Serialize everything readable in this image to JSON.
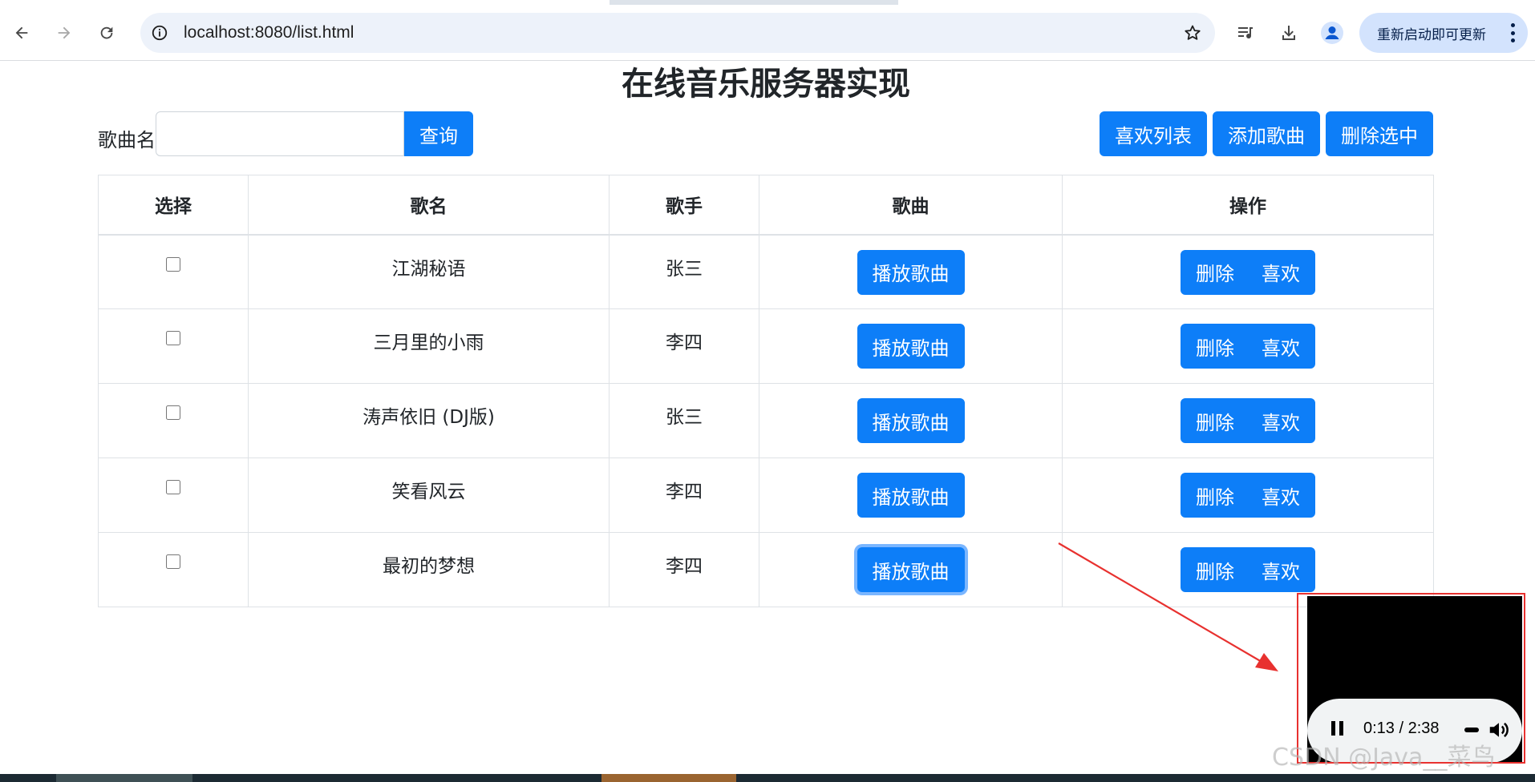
{
  "browser": {
    "url": "localhost:8080/list.html",
    "update_button_label": "重新启动即可更新"
  },
  "page": {
    "title": "在线音乐服务器实现",
    "search": {
      "label": "歌曲名",
      "value": "",
      "button_label": "查询"
    },
    "actions": {
      "like_list": "喜欢列表",
      "add_song": "添加歌曲",
      "delete_selected": "删除选中"
    },
    "table": {
      "headers": [
        "选择",
        "歌名",
        "歌手",
        "歌曲",
        "操作"
      ],
      "play_label": "播放歌曲",
      "delete_label": "删除",
      "like_label": "喜欢",
      "rows": [
        {
          "name": "江湖秘语",
          "singer": "张三"
        },
        {
          "name": "三月里的小雨",
          "singer": "李四"
        },
        {
          "name": "涛声依旧 (DJ版)",
          "singer": "张三"
        },
        {
          "name": "笑看风云",
          "singer": "李四"
        },
        {
          "name": "最初的梦想",
          "singer": "李四"
        }
      ]
    }
  },
  "player": {
    "time": "0:13 / 2:38"
  },
  "watermark": "CSDN @Java__菜鸟",
  "colors": {
    "primary_button": "#0d7ef8",
    "annotation": "#e8312f",
    "omnibox": "#edf2fa",
    "update_button": "#d3e3fd"
  }
}
